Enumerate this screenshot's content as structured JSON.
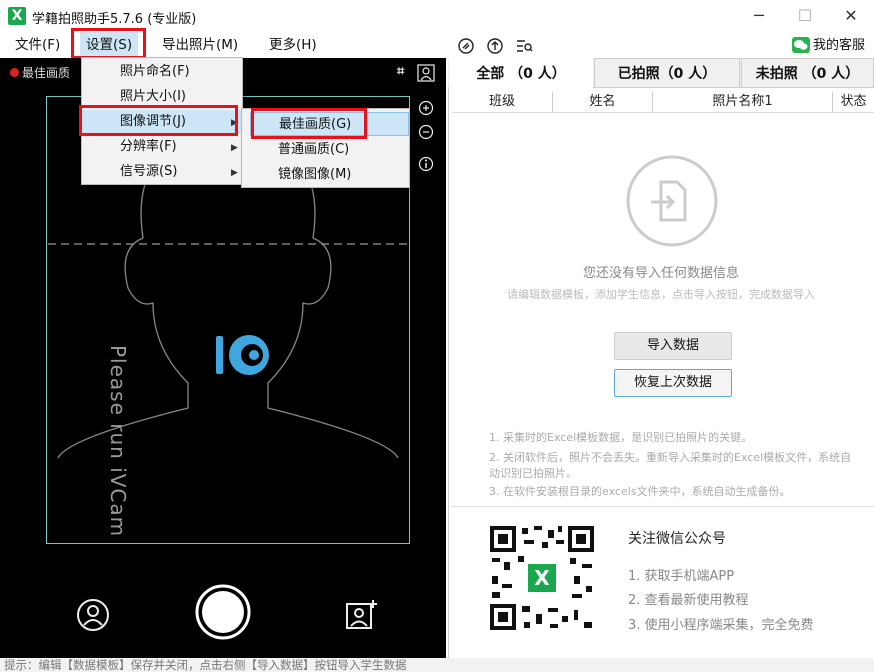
{
  "window": {
    "title": "学籍拍照助手5.7.6 (专业版)",
    "minimize": "─",
    "maximize": "☐",
    "close": "✕"
  },
  "menubar": {
    "file": "文件(F)",
    "settings": "设置(S)",
    "export": "导出照片(M)",
    "more": "更多(H)"
  },
  "toolbar": {
    "service_label": "我的客服",
    "icons": [
      "clip-icon",
      "upload-icon",
      "search-list-icon"
    ]
  },
  "camera": {
    "quality_label": "最佳画质",
    "placeholder_text": "Please run iVCam"
  },
  "settings_menu": {
    "items": [
      "照片命名(F)",
      "照片大小(I)",
      "图像调节(J)",
      "分辨率(F)",
      "信号源(S)"
    ]
  },
  "image_submenu": {
    "items": [
      "最佳画质(G)",
      "普通画质(C)",
      "镜像图像(M)"
    ]
  },
  "tabs": [
    "全部 （0 人）",
    "已拍照（0 人）",
    "未拍照 （0 人）"
  ],
  "table": {
    "columns": [
      "班级",
      "姓名",
      "照片名称1",
      "状态"
    ]
  },
  "empty": {
    "title": "您还没有导入任何数据信息",
    "subtitle": "请编辑数据模板，添加学生信息，点击导入按钮，完成数据导入"
  },
  "buttons": {
    "import": "导入数据",
    "restore": "恢复上次数据"
  },
  "tips": [
    "1. 采集时的Excel模板数据，是识别已拍照片的关键。",
    "2. 关闭软件后，照片不会丢失。重新导入采集时的Excel模板文件，系统自动识别已拍照片。",
    "3. 在软件安装根目录的excels文件夹中，系统自动生成备份。"
  ],
  "wechat": {
    "title": "关注微信公众号",
    "items": [
      "1. 获取手机端APP",
      "2. 查看最新使用教程",
      "3. 使用小程序端采集，完全免费"
    ]
  },
  "status": "提示：编辑【数据模板】保存并关闭，点击右侧【导入数据】按钮导入学生数据",
  "colors": {
    "accent": "#1aa84e",
    "frame": "#7bc7c0",
    "highlight": "#e8101a",
    "camera_logo": "#3ea7e0"
  }
}
